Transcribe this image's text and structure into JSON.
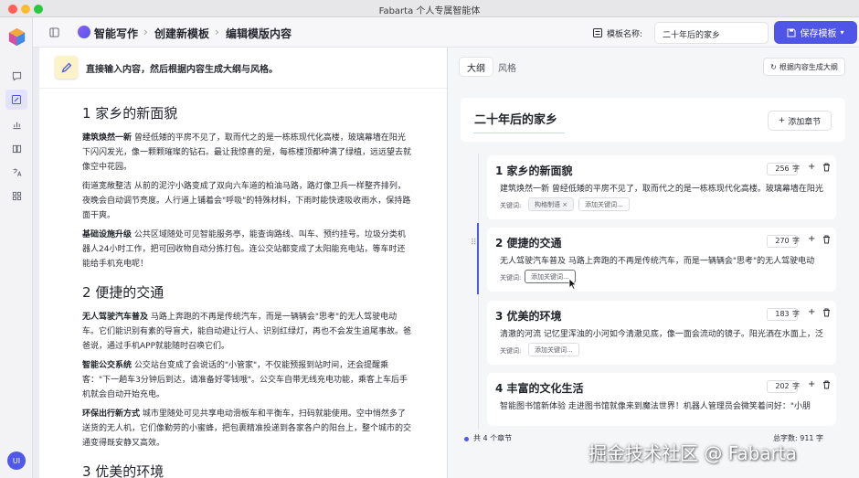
{
  "window": {
    "title": "Fabarta 个人专属智能体"
  },
  "rail": {
    "icons": [
      "app-logo",
      "chat-icon",
      "write-icon",
      "chart-icon",
      "book-icon",
      "translate-icon",
      "grid-icon"
    ],
    "avatar": "UI"
  },
  "header": {
    "breadcrumb": [
      "智能写作",
      "创建新模板",
      "编辑模版内容"
    ],
    "separator": "›",
    "template_label": "模板名称:",
    "template_name": "二十年后的家乡",
    "save_label": "保存模板",
    "accent": "#4f55e6"
  },
  "editor": {
    "hint": "直接输入内容，然后根据内容生成大纲与风格。",
    "sections": [
      {
        "heading": "1 家乡的新面貌",
        "paragraphs": [
          {
            "lead": "建筑焕然一新",
            "text": " 曾经低矮的平房不见了，取而代之的是一栋栋现代化高楼，玻璃幕墙在阳光下闪闪发光，像一颗颗璀璨的钻石。最让我惊喜的是，每栋楼顶都种满了绿植，远远望去就像空中花园。"
          },
          {
            "lead": "",
            "text": "街道宽敞整洁 从前的泥泞小路变成了双向六车道的柏油马路，路灯像卫兵一样整齐排列，夜晚会自动调节亮度。人行道上铺着会\"呼吸\"的特殊材料，下雨时能快速吸收雨水，保持路面干爽。"
          },
          {
            "lead": "基础设施升级",
            "text": " 公共区域随处可见智能服务亭，能查询路线、叫车、预约挂号。垃圾分类机器人24小时工作，把可回收物自动分拣打包。连公交站都变成了太阳能充电站，等车时还能给手机充电呢！"
          }
        ]
      },
      {
        "heading": "2 便捷的交通",
        "paragraphs": [
          {
            "lead": "无人驾驶汽车普及",
            "text": " 马路上奔跑的不再是传统汽车，而是一辆辆会\"思考\"的无人驾驶电动车。它们能识别有素的导盲犬，能自动避让行人、识别红绿灯，再也不会发生追尾事故。爸爸说，通过手机APP就能随时召唤它们。"
          },
          {
            "lead": "智能公交系统",
            "text": " 公交站台变成了会说话的\"小管家\"，不仅能预报到站时间，还会提醒乘客：\"下一趟车3分钟后到达，请准备好零钱哦\"。公交车自带无线充电功能，乘客上车后手机就会自动开始充电。"
          },
          {
            "lead": "环保出行新方式",
            "text": " 城市里随处可见共享电动滑板车和平衡车，扫码就能使用。空中悄然多了送货的无人机，它们像勤劳的小蜜蜂，把包裹精准投递到各家各户的阳台上，整个城市的交通变得既安静又高效。"
          }
        ]
      },
      {
        "heading": "3 优美的环境",
        "paragraphs": []
      }
    ]
  },
  "outline": {
    "tabs": [
      "大纲",
      "风格"
    ],
    "generate_label": "根据内容生成大纲",
    "title": "二十年后的家乡",
    "add_chapter_label": "添加章节",
    "keyword_label": "关键词:",
    "unit": "字",
    "chapters": [
      {
        "title": "1 家乡的新面貌",
        "count": "256",
        "summary": "建筑焕然一新 曾经低矮的平房不见了，取而代之的是一栋栋现代化高楼。玻璃幕墙在阳光",
        "keywords": [
          "构格制语"
        ],
        "add_keyword": "添加关键词..."
      },
      {
        "title": "2 便捷的交通",
        "count": "270",
        "summary": "无人驾驶汽车普及 马路上奔跑的不再是传统汽车，而是一辆辆会\"思考\"的无人驾驶电动",
        "keywords": [],
        "add_keyword": "添加关键词..."
      },
      {
        "title": "3 优美的环境",
        "count": "183",
        "summary": "清澈的河流 记忆里浑浊的小河如今清澈见底，像一面会流动的镜子。阳光洒在水面上，泛",
        "keywords": [],
        "add_keyword": "添加关键词..."
      },
      {
        "title": "4 丰富的文化生活",
        "count": "202",
        "summary": "智能图书馆新体验 走进图书馆就像来到魔法世界！机器人管理员会微笑着问好：\"小朋",
        "keywords": [],
        "add_keyword": ""
      }
    ],
    "footer_count": "共 4 个章节",
    "footer_total": "总字数: 911 字"
  },
  "watermark": "掘金技术社区 @ Fabarta"
}
